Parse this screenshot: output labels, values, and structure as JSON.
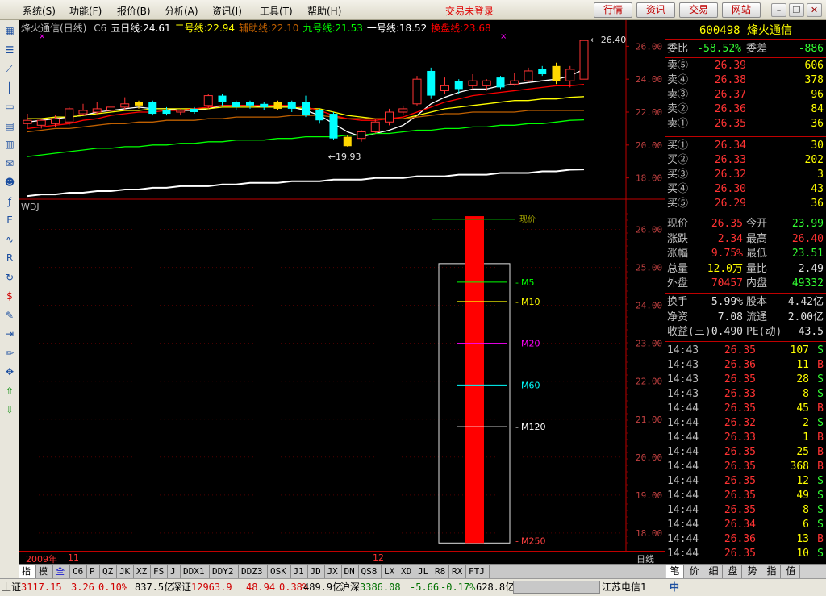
{
  "menu": {
    "items": [
      "系统(S)",
      "功能(F)",
      "报价(B)",
      "分析(A)",
      "资讯(I)",
      "工具(T)",
      "帮助(H)"
    ],
    "login_status": "交易未登录",
    "top_buttons": [
      "行情",
      "资讯",
      "交易",
      "网站"
    ],
    "window_buttons": [
      "minimize",
      "restore",
      "close"
    ]
  },
  "chart": {
    "title": "烽火通信(日线)",
    "indicators": [
      {
        "label": "C6",
        "color": "#c0c0c0"
      },
      {
        "label": "五日线:24.61",
        "color": "#ffffff"
      },
      {
        "label": "二号线:22.94",
        "color": "#ffff00"
      },
      {
        "label": "辅助线:22.10",
        "color": "#c06000"
      },
      {
        "label": "九号线:21.53",
        "color": "#00ff00"
      },
      {
        "label": "一号线:18.52",
        "color": "#ffffff"
      },
      {
        "label": "换盘线:23.68",
        "color": "#ff0000"
      }
    ],
    "price_axis_top": [
      "26.00",
      "24.00",
      "22.00",
      "20.00",
      "18.00"
    ],
    "annotation_high": "26.40",
    "annotation_low": "19.93",
    "lower_title": "WDJ",
    "lower_axis": [
      "26.00",
      "25.00",
      "24.00",
      "23.00",
      "22.00",
      "21.00",
      "20.00",
      "19.00",
      "18.00"
    ],
    "ma_labels": [
      {
        "label": "M5",
        "color": "#00ff00"
      },
      {
        "label": "M10",
        "color": "#ffff00"
      },
      {
        "label": "M20",
        "color": "#ff00ff"
      },
      {
        "label": "M60",
        "color": "#00ffff"
      },
      {
        "label": "M120",
        "color": "#ffffff"
      },
      {
        "label": "M250",
        "color": "#ff4040"
      }
    ],
    "top_cut_label": "现价",
    "date_axis": {
      "year": "2009年",
      "month1": "11",
      "month2": "12"
    },
    "period_label": "日线"
  },
  "chart_data": {
    "type": "candlestick",
    "title": "烽火通信(日线)",
    "y_range": [
      17.2,
      26.8
    ],
    "candles": [
      {
        "o": 21.3,
        "c": 21.5,
        "h": 21.9,
        "l": 21.0
      },
      {
        "o": 21.2,
        "c": 21.5,
        "h": 21.6,
        "l": 21.0
      },
      {
        "o": 21.3,
        "c": 21.6,
        "h": 21.8,
        "l": 21.1
      },
      {
        "o": 21.4,
        "c": 22.2,
        "h": 22.3,
        "l": 21.2
      },
      {
        "o": 21.9,
        "c": 22.1,
        "h": 22.5,
        "l": 21.8
      },
      {
        "o": 22.0,
        "c": 22.2,
        "h": 22.6,
        "l": 21.8
      },
      {
        "o": 22.1,
        "c": 22.3,
        "h": 22.7,
        "l": 21.9
      },
      {
        "o": 22.3,
        "c": 22.5,
        "h": 22.9,
        "l": 22.1
      },
      {
        "o": 22.6,
        "c": 22.4,
        "h": 22.7,
        "l": 22.2
      },
      {
        "o": 22.6,
        "c": 21.9,
        "h": 22.7,
        "l": 21.8
      },
      {
        "o": 22.1,
        "c": 21.9,
        "h": 22.3,
        "l": 21.8
      },
      {
        "o": 22.0,
        "c": 22.1,
        "h": 22.2,
        "l": 21.8
      },
      {
        "o": 22.2,
        "c": 22.0,
        "h": 22.3,
        "l": 21.9
      },
      {
        "o": 22.4,
        "c": 23.0,
        "h": 23.1,
        "l": 22.2
      },
      {
        "o": 23.0,
        "c": 22.6,
        "h": 23.1,
        "l": 22.4
      },
      {
        "o": 22.6,
        "c": 22.3,
        "h": 22.7,
        "l": 22.1
      },
      {
        "o": 22.6,
        "c": 22.4,
        "h": 22.7,
        "l": 22.2
      },
      {
        "o": 22.5,
        "c": 22.3,
        "h": 22.6,
        "l": 22.1
      },
      {
        "o": 22.6,
        "c": 22.2,
        "h": 22.7,
        "l": 22.1
      },
      {
        "o": 22.6,
        "c": 22.2,
        "h": 22.7,
        "l": 22.0
      },
      {
        "o": 22.6,
        "c": 21.8,
        "h": 23.0,
        "l": 21.7
      },
      {
        "o": 22.1,
        "c": 21.5,
        "h": 22.2,
        "l": 21.3
      },
      {
        "o": 21.9,
        "c": 20.4,
        "h": 22.0,
        "l": 20.3
      },
      {
        "o": 20.5,
        "c": 19.93,
        "h": 20.6,
        "l": 19.9
      },
      {
        "o": 20.4,
        "c": 20.8,
        "h": 20.9,
        "l": 20.2
      },
      {
        "o": 20.8,
        "c": 21.4,
        "h": 21.6,
        "l": 20.7
      },
      {
        "o": 21.4,
        "c": 22.0,
        "h": 22.2,
        "l": 21.2
      },
      {
        "o": 22.0,
        "c": 22.2,
        "h": 22.4,
        "l": 21.8
      },
      {
        "o": 22.5,
        "c": 24.0,
        "h": 24.2,
        "l": 22.4
      },
      {
        "o": 24.5,
        "c": 23.0,
        "h": 24.7,
        "l": 22.8
      },
      {
        "o": 23.3,
        "c": 23.6,
        "h": 24.1,
        "l": 23.1
      },
      {
        "o": 23.9,
        "c": 23.4,
        "h": 24.0,
        "l": 23.1
      },
      {
        "o": 23.6,
        "c": 23.9,
        "h": 24.3,
        "l": 23.4
      },
      {
        "o": 23.6,
        "c": 23.9,
        "h": 24.0,
        "l": 23.3
      },
      {
        "o": 24.1,
        "c": 23.5,
        "h": 24.2,
        "l": 23.4
      },
      {
        "o": 23.7,
        "c": 23.9,
        "h": 24.4,
        "l": 23.6
      },
      {
        "o": 23.9,
        "c": 24.5,
        "h": 24.7,
        "l": 23.8
      },
      {
        "o": 24.6,
        "c": 24.3,
        "h": 24.8,
        "l": 24.2
      },
      {
        "o": 24.8,
        "c": 23.9,
        "h": 25.0,
        "l": 23.7
      },
      {
        "o": 23.9,
        "c": 24.6,
        "h": 24.8,
        "l": 23.5
      },
      {
        "o": 24.0,
        "c": 26.35,
        "h": 26.4,
        "l": 23.99
      }
    ],
    "ma_lines": [
      {
        "name": "五日线",
        "color": "#ffffff",
        "values": [
          21.4,
          21.5,
          21.6,
          21.7,
          21.8,
          22.0,
          22.1,
          22.2,
          22.3,
          22.2,
          22.2,
          22.1,
          22.1,
          22.2,
          22.4,
          22.4,
          22.4,
          22.3,
          22.3,
          22.3,
          22.1,
          21.8,
          21.3,
          20.8,
          20.5,
          20.7,
          20.9,
          21.2,
          21.8,
          22.5,
          22.9,
          23.2,
          23.4,
          23.4,
          23.6,
          23.7,
          23.8,
          23.9,
          24.0,
          24.2,
          24.61
        ]
      },
      {
        "name": "二号线",
        "color": "#ffff00",
        "values": [
          21.6,
          21.6,
          21.7,
          21.7,
          21.8,
          21.9,
          22.0,
          22.1,
          22.1,
          22.2,
          22.2,
          22.2,
          22.2,
          22.2,
          22.3,
          22.3,
          22.3,
          22.3,
          22.3,
          22.3,
          22.2,
          22.2,
          22.0,
          21.8,
          21.7,
          21.6,
          21.6,
          21.6,
          21.8,
          22.0,
          22.2,
          22.3,
          22.4,
          22.5,
          22.6,
          22.7,
          22.7,
          22.8,
          22.8,
          22.9,
          22.94
        ]
      },
      {
        "name": "辅助线",
        "color": "#c06000",
        "values": [
          20.8,
          20.9,
          21.0,
          21.0,
          21.1,
          21.2,
          21.3,
          21.3,
          21.4,
          21.4,
          21.5,
          21.5,
          21.5,
          21.6,
          21.6,
          21.7,
          21.7,
          21.7,
          21.7,
          21.8,
          21.8,
          21.8,
          21.7,
          21.6,
          21.6,
          21.6,
          21.6,
          21.6,
          21.7,
          21.8,
          21.9,
          21.9,
          22.0,
          22.0,
          22.0,
          22.0,
          22.1,
          22.1,
          22.1,
          22.1,
          22.1
        ]
      },
      {
        "name": "九号线",
        "color": "#00ff00",
        "values": [
          19.3,
          19.4,
          19.5,
          19.6,
          19.7,
          19.8,
          19.8,
          19.9,
          19.9,
          20.0,
          20.0,
          20.1,
          20.1,
          20.2,
          20.2,
          20.3,
          20.3,
          20.3,
          20.4,
          20.4,
          20.5,
          20.5,
          20.5,
          20.6,
          20.6,
          20.7,
          20.7,
          20.8,
          20.9,
          20.9,
          21.0,
          21.0,
          21.1,
          21.1,
          21.2,
          21.2,
          21.3,
          21.3,
          21.4,
          21.5,
          21.53
        ]
      },
      {
        "name": "一号线",
        "color": "#ffffff",
        "values": [
          16.9,
          17.0,
          17.0,
          17.1,
          17.1,
          17.2,
          17.2,
          17.3,
          17.3,
          17.4,
          17.4,
          17.5,
          17.5,
          17.5,
          17.6,
          17.6,
          17.7,
          17.7,
          17.7,
          17.8,
          17.8,
          17.8,
          17.9,
          17.9,
          17.9,
          18.0,
          18.0,
          18.0,
          18.1,
          18.1,
          18.1,
          18.2,
          18.2,
          18.2,
          18.3,
          18.3,
          18.3,
          18.4,
          18.4,
          18.5,
          18.52
        ]
      },
      {
        "name": "换盘线",
        "color": "#ff0000",
        "values": [
          21.0,
          21.1,
          21.2,
          21.3,
          21.5,
          21.6,
          21.8,
          21.9,
          22.0,
          22.0,
          22.1,
          22.1,
          22.2,
          22.3,
          22.4,
          22.4,
          22.4,
          22.4,
          22.4,
          22.4,
          22.3,
          22.1,
          21.8,
          21.6,
          21.5,
          21.5,
          21.6,
          21.7,
          22.0,
          22.3,
          22.6,
          22.8,
          23.0,
          23.1,
          23.2,
          23.3,
          23.4,
          23.5,
          23.6,
          23.6,
          23.68
        ]
      }
    ],
    "lower": {
      "y_range": [
        17.7,
        26.5
      ],
      "bar_low": 17.8,
      "bar_high": 26.35,
      "levels": [
        {
          "name": "M5",
          "value": 24.61,
          "color": "#00ff00"
        },
        {
          "name": "M10",
          "value": 24.1,
          "color": "#ffff00"
        },
        {
          "name": "M20",
          "value": 23.0,
          "color": "#ff00ff"
        },
        {
          "name": "M60",
          "value": 21.9,
          "color": "#00ffff"
        },
        {
          "name": "M120",
          "value": 20.8,
          "color": "#ffffff"
        },
        {
          "name": "M250",
          "value": 17.8,
          "color": "#ff4040"
        }
      ]
    }
  },
  "quote": {
    "code": "600498",
    "name": "烽火通信",
    "weibi_label": "委比",
    "weibi": "-58.52%",
    "weicha_label": "委差",
    "weicha": "-886",
    "asks": [
      {
        "label": "卖⑤",
        "price": "26.39",
        "vol": "606"
      },
      {
        "label": "卖④",
        "price": "26.38",
        "vol": "378"
      },
      {
        "label": "卖③",
        "price": "26.37",
        "vol": "96"
      },
      {
        "label": "卖②",
        "price": "26.36",
        "vol": "84"
      },
      {
        "label": "卖①",
        "price": "26.35",
        "vol": "36"
      }
    ],
    "bids": [
      {
        "label": "买①",
        "price": "26.34",
        "vol": "30"
      },
      {
        "label": "买②",
        "price": "26.33",
        "vol": "202"
      },
      {
        "label": "买③",
        "price": "26.32",
        "vol": "3"
      },
      {
        "label": "买④",
        "price": "26.30",
        "vol": "43"
      },
      {
        "label": "买⑤",
        "price": "26.29",
        "vol": "36"
      }
    ],
    "stats": [
      {
        "l1": "现价",
        "v1": "26.35",
        "c1": "red",
        "l2": "今开",
        "v2": "23.99",
        "c2": "green"
      },
      {
        "l1": "涨跌",
        "v1": "2.34",
        "c1": "red",
        "l2": "最高",
        "v2": "26.40",
        "c2": "red"
      },
      {
        "l1": "涨幅",
        "v1": "9.75%",
        "c1": "red",
        "l2": "最低",
        "v2": "23.51",
        "c2": "green"
      },
      {
        "l1": "总量",
        "v1": "12.0万",
        "c1": "yel",
        "l2": "量比",
        "v2": "2.49",
        "c2": "white"
      },
      {
        "l1": "外盘",
        "v1": "70457",
        "c1": "red",
        "l2": "内盘",
        "v2": "49332",
        "c2": "green"
      }
    ],
    "stats2": [
      {
        "l1": "换手",
        "v1": "5.99%",
        "c1": "white",
        "l2": "股本",
        "v2": "4.42亿",
        "c2": "white"
      },
      {
        "l1": "净资",
        "v1": "7.08",
        "c1": "white",
        "l2": "流通",
        "v2": "2.00亿",
        "c2": "white"
      },
      {
        "l1": "收益(三)",
        "v1": "0.490",
        "c1": "white",
        "l2": "PE(动)",
        "v2": "43.5",
        "c2": "white"
      }
    ],
    "ticks": [
      {
        "time": "14:43",
        "price": "26.35",
        "vol": "107",
        "side": "S"
      },
      {
        "time": "14:43",
        "price": "26.36",
        "vol": "11",
        "side": "B"
      },
      {
        "time": "14:43",
        "price": "26.35",
        "vol": "28",
        "side": "S"
      },
      {
        "time": "14:43",
        "price": "26.33",
        "vol": "8",
        "side": "S"
      },
      {
        "time": "14:44",
        "price": "26.35",
        "vol": "45",
        "side": "B"
      },
      {
        "time": "14:44",
        "price": "26.32",
        "vol": "2",
        "side": "S"
      },
      {
        "time": "14:44",
        "price": "26.33",
        "vol": "1",
        "side": "B"
      },
      {
        "time": "14:44",
        "price": "26.35",
        "vol": "25",
        "side": "B"
      },
      {
        "time": "14:44",
        "price": "26.35",
        "vol": "368",
        "side": "B"
      },
      {
        "time": "14:44",
        "price": "26.35",
        "vol": "12",
        "side": "S"
      },
      {
        "time": "14:44",
        "price": "26.35",
        "vol": "49",
        "side": "S"
      },
      {
        "time": "14:44",
        "price": "26.35",
        "vol": "8",
        "side": "S"
      },
      {
        "time": "14:44",
        "price": "26.34",
        "vol": "6",
        "side": "S"
      },
      {
        "time": "14:44",
        "price": "26.36",
        "vol": "13",
        "side": "B"
      },
      {
        "time": "14:44",
        "price": "26.35",
        "vol": "10",
        "side": "S"
      }
    ]
  },
  "tabs": [
    "指标",
    "模板",
    "全部",
    "C6",
    "P",
    "QZ",
    "JK",
    "XZ",
    "FS",
    "J",
    "DDX1",
    "DDY2",
    "DDZ3",
    "OSK",
    "J1",
    "JD",
    "JX",
    "DN",
    "QS8",
    "LX",
    "XD",
    "JL",
    "R8",
    "RX",
    "FTJ"
  ],
  "right_tabs": [
    "笔",
    "价",
    "细",
    "盘",
    "势",
    "指",
    "值"
  ],
  "status": {
    "sh_label": "上证",
    "sh_val": "3117.15",
    "sh_chg": "3.26",
    "sh_pct": "0.10%",
    "sh_amt": "837.5亿",
    "sz_label": "深证",
    "sz_val": "12963.9",
    "sz_chg": "48.94",
    "sz_pct": "0.38%",
    "sz_amt": "489.9亿",
    "hs_label": "沪深",
    "hs_val": "3386.08",
    "hs_chg": "-5.66",
    "hs_pct": "-0.17%",
    "hs_amt": "628.8亿",
    "broker": "江苏电信1",
    "ime": "中"
  },
  "colors": {
    "up": "#ff3333",
    "down": "#00ffff",
    "grid": "#600000",
    "panel_border": "#c00000"
  },
  "left_icons": [
    "grid-icon",
    "list-icon",
    "line-chart-icon",
    "candle-icon",
    "window-icon",
    "table-icon",
    "report-icon",
    "mail-icon",
    "people-icon",
    "fund-icon",
    "etf-icon",
    "wave-icon",
    "rsi-icon",
    "refresh-icon",
    "dollar-icon",
    "wrench-icon",
    "exit-icon",
    "pencil-icon",
    "move-icon",
    "up-arrow-icon",
    "down-arrow-icon"
  ]
}
